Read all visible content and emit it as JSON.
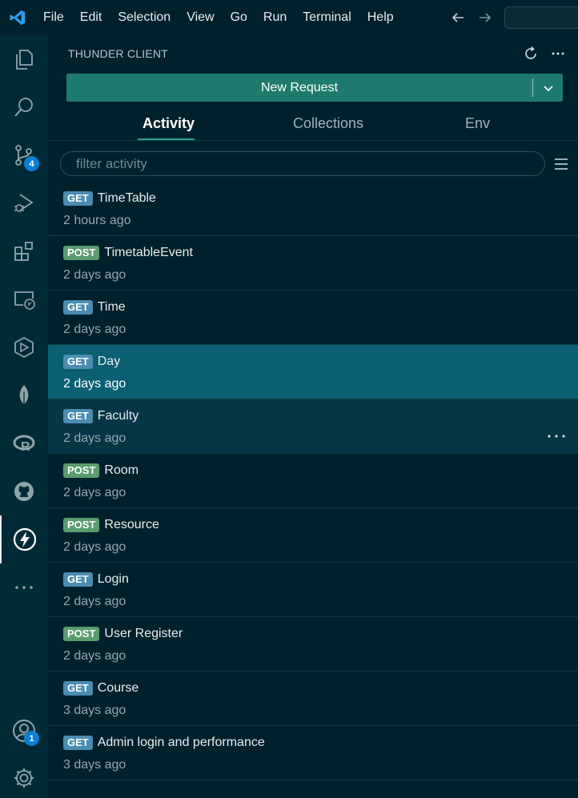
{
  "menu": [
    "File",
    "Edit",
    "Selection",
    "View",
    "Go",
    "Run",
    "Terminal",
    "Help"
  ],
  "activity_bar": {
    "items": [
      {
        "icon": "explorer-icon"
      },
      {
        "icon": "search-icon"
      },
      {
        "icon": "source-control-icon",
        "badge": "4"
      },
      {
        "icon": "run-debug-icon"
      },
      {
        "icon": "extensions-icon"
      },
      {
        "icon": "remote-explorer-icon"
      },
      {
        "icon": "container-icon"
      },
      {
        "icon": "mongodb-leaf-icon"
      },
      {
        "icon": "r-language-icon"
      },
      {
        "icon": "github-icon"
      },
      {
        "icon": "thunder-client-icon"
      },
      {
        "icon": "more-icon"
      }
    ],
    "account_badge": "1"
  },
  "panel": {
    "title": "THUNDER CLIENT",
    "new_request_label": "New Request",
    "tabs": [
      "Activity",
      "Collections",
      "Env"
    ],
    "active_tab": "Activity",
    "filter_placeholder": "filter activity"
  },
  "requests": [
    {
      "method": "GET",
      "name": "TimeTable",
      "time": "2 hours ago"
    },
    {
      "method": "POST",
      "name": "TimetableEvent",
      "time": "2 days ago"
    },
    {
      "method": "GET",
      "name": "Time",
      "time": "2 days ago"
    },
    {
      "method": "GET",
      "name": "Day",
      "time": "2 days ago",
      "state": "selected"
    },
    {
      "method": "GET",
      "name": "Faculty",
      "time": "2 days ago",
      "state": "hovered"
    },
    {
      "method": "POST",
      "name": "Room",
      "time": "2 days ago"
    },
    {
      "method": "POST",
      "name": "Resource",
      "time": "2 days ago"
    },
    {
      "method": "GET",
      "name": "Login",
      "time": "2 days ago"
    },
    {
      "method": "POST",
      "name": "User Register",
      "time": "2 days ago"
    },
    {
      "method": "GET",
      "name": "Course",
      "time": "3 days ago"
    },
    {
      "method": "GET",
      "name": "Admin login and performance",
      "time": "3 days ago"
    }
  ],
  "colors": {
    "get": "#4a8db1",
    "post": "#5a9c6e",
    "new_request": "#1f7a6e",
    "selected_row": "#0b5f72",
    "accent": "#2aa198"
  }
}
